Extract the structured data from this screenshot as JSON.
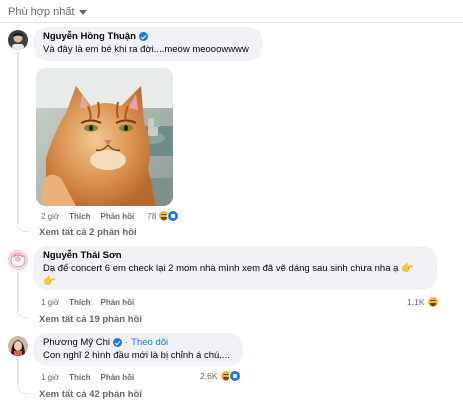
{
  "filter": {
    "label": "Phù hợp nhất"
  },
  "comments": [
    {
      "author": "Nguyễn Hồng Thuận",
      "text": "Và đây là em bé khi ra đời....meow meooowwww",
      "time": "2 giờ",
      "like": "Thích",
      "reply": "Phản hồi",
      "reaction_count": "78",
      "replies_link": "Xem tất cả 2 phản hồi"
    },
    {
      "author": "Nguyễn Thái Sơn",
      "text": "Dạ để concert 6 em check lại 2 mom nhà mình xem đã vẽ dáng sau sinh chưa nha ạ",
      "time": "1 giờ",
      "like": "Thích",
      "reply": "Phản hồi",
      "reaction_count": "1,1K",
      "replies_link": "Xem tất cả 19 phản hồi"
    },
    {
      "author": "Phương Mỹ Chi",
      "follow": "Theo dõi",
      "separator": "·",
      "text": "Con nghĩ 2 hình đầu mới là bị chỉnh á chú....",
      "time": "1 giờ",
      "like": "Thích",
      "reply": "Phản hồi",
      "reaction_count": "2,6K",
      "replies_link": "Xem tất cả 42 phản hồi"
    }
  ],
  "colors": {
    "link": "#1877f2",
    "bubble": "#f0f2f5",
    "muted": "#65676b"
  }
}
